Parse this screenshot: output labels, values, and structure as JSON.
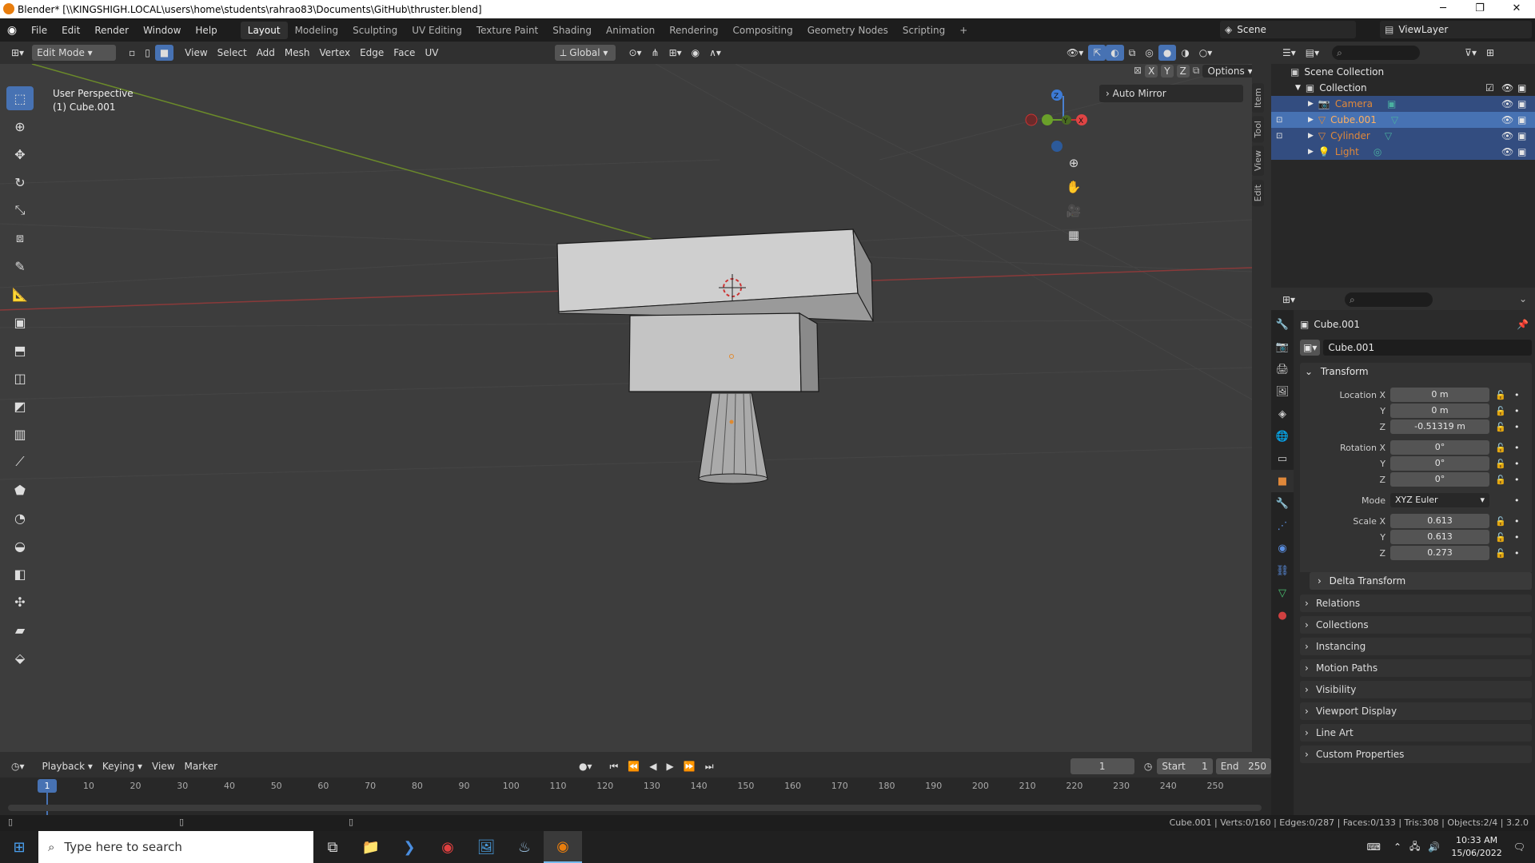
{
  "window": {
    "title": "Blender* [\\\\KINGSHIGH.LOCAL\\users\\home\\students\\rahrao83\\Documents\\GitHub\\thruster.blend]"
  },
  "menu": [
    "File",
    "Edit",
    "Render",
    "Window",
    "Help"
  ],
  "workspaces": [
    "Layout",
    "Modeling",
    "Sculpting",
    "UV Editing",
    "Texture Paint",
    "Shading",
    "Animation",
    "Rendering",
    "Compositing",
    "Geometry Nodes",
    "Scripting"
  ],
  "scene": {
    "name": "Scene",
    "view_layer": "ViewLayer"
  },
  "viewport_header": {
    "mode": "Edit Mode",
    "menus": [
      "View",
      "Select",
      "Add",
      "Mesh",
      "Vertex",
      "Edge",
      "Face",
      "UV"
    ],
    "orientation": "Global",
    "options": "Options",
    "axes": [
      "X",
      "Y",
      "Z"
    ]
  },
  "viewport": {
    "perspective": "User Perspective",
    "object": "(1) Cube.001",
    "auto_mirror": "Auto Mirror",
    "gizmo_axes": [
      "Z",
      "Y",
      "X"
    ]
  },
  "sidebar_tabs": [
    "Item",
    "Tool",
    "View",
    "Edit"
  ],
  "outliner": {
    "root": "Scene Collection",
    "collection": "Collection",
    "items": [
      {
        "name": "Camera",
        "color": "#e0883a"
      },
      {
        "name": "Cube.001",
        "color": "#e0883a"
      },
      {
        "name": "Cylinder",
        "color": "#e0883a"
      },
      {
        "name": "Light",
        "color": "#e0883a"
      }
    ]
  },
  "properties": {
    "object_name": "Cube.001",
    "datablock": "Cube.001",
    "transform_label": "Transform",
    "location": {
      "label": "Location X",
      "x": "0 m",
      "y": "0 m",
      "z": "-0.51319 m"
    },
    "rotation": {
      "label": "Rotation X",
      "x": "0°",
      "y": "0°",
      "z": "0°"
    },
    "mode": {
      "label": "Mode",
      "value": "XYZ Euler"
    },
    "scale": {
      "label": "Scale X",
      "x": "0.613",
      "y": "0.613",
      "z": "0.273"
    },
    "axis_y": "Y",
    "axis_z": "Z",
    "delta": "Delta Transform",
    "panels": [
      "Relations",
      "Collections",
      "Instancing",
      "Motion Paths",
      "Visibility",
      "Viewport Display",
      "Line Art",
      "Custom Properties"
    ]
  },
  "timeline": {
    "menus": [
      "Playback",
      "Keying",
      "View",
      "Marker"
    ],
    "current_frame": "1",
    "start_label": "Start",
    "start": "1",
    "end_label": "End",
    "end": "250",
    "ticks": [
      "1",
      "10",
      "20",
      "30",
      "40",
      "50",
      "60",
      "70",
      "80",
      "90",
      "100",
      "110",
      "120",
      "130",
      "140",
      "150",
      "160",
      "170",
      "180",
      "190",
      "200",
      "210",
      "220",
      "230",
      "240",
      "250"
    ]
  },
  "status": {
    "text": "Cube.001 | Verts:0/160 | Edges:0/287 | Faces:0/133 | Tris:308 | Objects:2/4 | 3.2.0"
  },
  "taskbar": {
    "search": "Type here to search",
    "time": "10:33 AM",
    "date": "15/06/2022"
  },
  "colors": {
    "accent": "#4772b3",
    "selected_row": "#334d80",
    "orange": "#e0883a"
  }
}
